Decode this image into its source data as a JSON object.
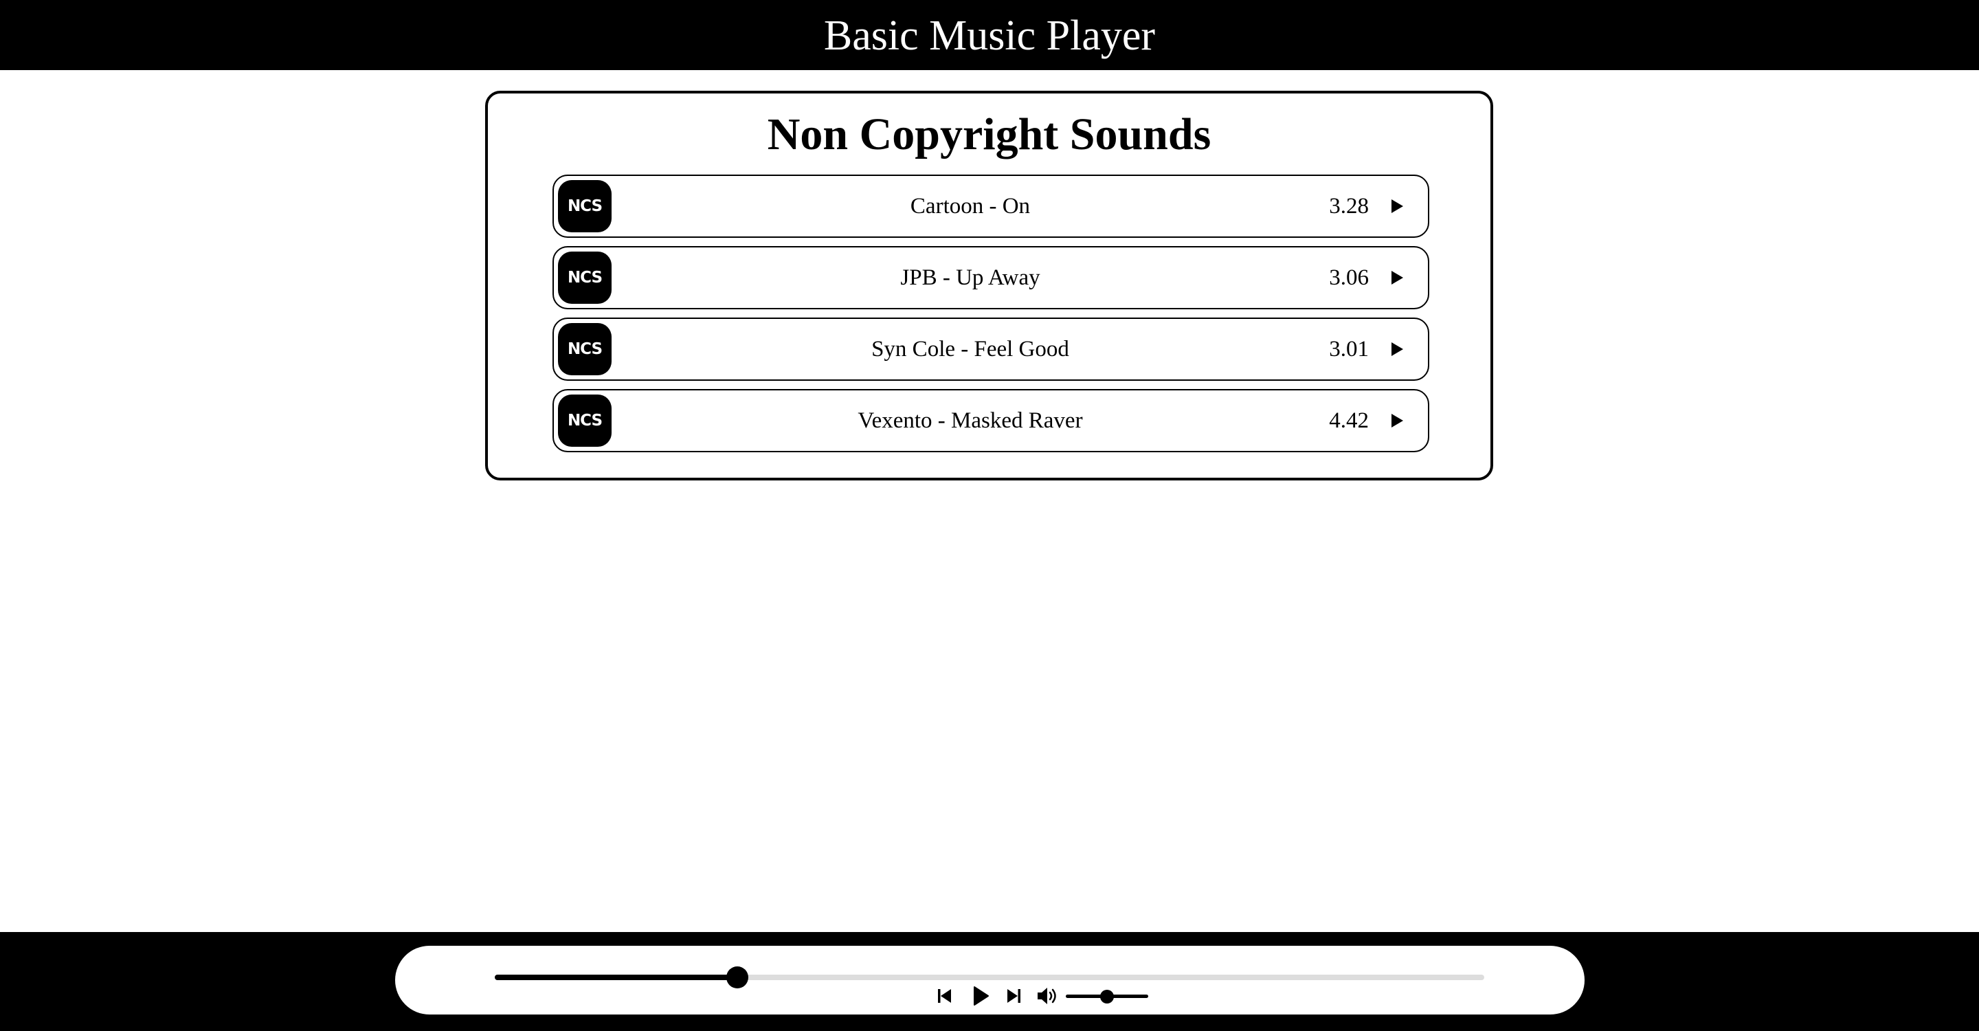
{
  "header": {
    "title": "Basic Music Player"
  },
  "playlist": {
    "title": "Non Copyright Sounds",
    "logo_text": "NCS",
    "tracks": [
      {
        "name": "Cartoon - On",
        "duration": "3.28"
      },
      {
        "name": "JPB - Up Away",
        "duration": "3.06"
      },
      {
        "name": "Syn Cole - Feel Good",
        "duration": "3.01"
      },
      {
        "name": "Vexento - Masked Raver",
        "duration": "4.42"
      }
    ]
  },
  "player": {
    "progress_fraction": 0.245,
    "volume_fraction": 0.5,
    "controls": [
      "previous-icon",
      "play-icon",
      "next-icon",
      "volume-icon"
    ]
  },
  "colors": {
    "primary": "#000000",
    "background": "#ffffff",
    "track_rail": "#dddddd"
  }
}
